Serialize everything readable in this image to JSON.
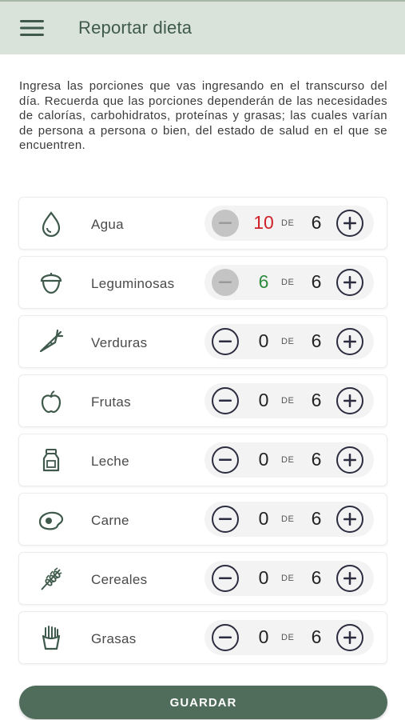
{
  "header": {
    "title": "Reportar dieta",
    "menu_icon": "hamburger-menu-icon"
  },
  "intro": {
    "text": "Ingresa las porciones que vas ingresando en el transcurso del día. Recuerda que las porciones dependerán de las  necesidades de calorías, carbohidratos, proteínas y grasas; las cuales varían de persona a persona o bien, del estado de salud en el que se encuentren."
  },
  "colors": {
    "appbar": "#d9e3d9",
    "primary": "#4f6d5a",
    "icon": "#3f5a4c",
    "over": "#d0202a",
    "met": "#2e8b3e"
  },
  "de_label": "DE",
  "items": [
    {
      "label": "Agua",
      "icon": "water-drop-icon",
      "count": "10",
      "total": "6",
      "status": "over"
    },
    {
      "label": "Leguminosas",
      "icon": "acorn-icon",
      "count": "6",
      "total": "6",
      "status": "met"
    },
    {
      "label": "Verduras",
      "icon": "carrot-icon",
      "count": "0",
      "total": "6",
      "status": "normal"
    },
    {
      "label": "Frutas",
      "icon": "apple-icon",
      "count": "0",
      "total": "6",
      "status": "normal"
    },
    {
      "label": "Leche",
      "icon": "milk-bottle-icon",
      "count": "0",
      "total": "6",
      "status": "normal"
    },
    {
      "label": "Carne",
      "icon": "steak-icon",
      "count": "0",
      "total": "6",
      "status": "normal"
    },
    {
      "label": "Cereales",
      "icon": "wheat-icon",
      "count": "0",
      "total": "6",
      "status": "normal"
    },
    {
      "label": "Grasas",
      "icon": "fries-icon",
      "count": "0",
      "total": "6",
      "status": "normal"
    }
  ],
  "save_button": {
    "label": "GUARDAR"
  }
}
